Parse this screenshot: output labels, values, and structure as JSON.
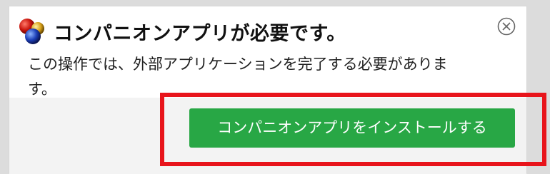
{
  "dialog": {
    "title": "コンパニオンアプリが必要です。",
    "message": "この操作では、外部アプリケーションを完了する必要がありま\nす。",
    "install_button_label": "コンパニオンアプリをインストールする",
    "logo_icon": "companion-app-logo-icon",
    "close_icon": "close-circle-icon"
  },
  "colors": {
    "install_button": "#28a745",
    "highlight": "#e8141b"
  }
}
